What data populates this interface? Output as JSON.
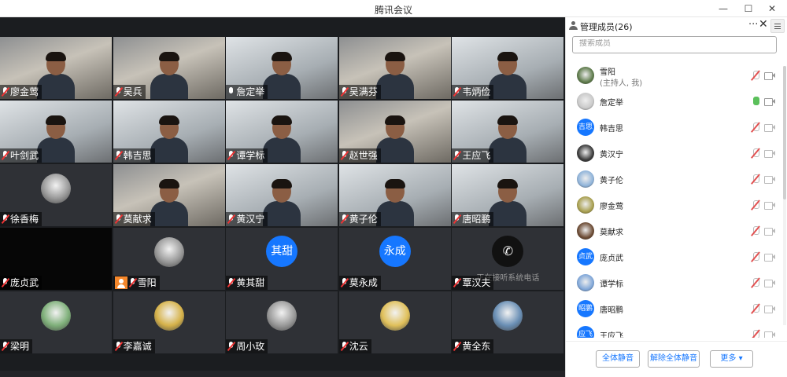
{
  "window": {
    "title": "腾讯会议",
    "minimize": "—",
    "maximize": "☐",
    "close": "✕"
  },
  "tiles": [
    {
      "name": "廖金莺",
      "mic": "off",
      "kind": "photo"
    },
    {
      "name": "吴兵",
      "mic": "off",
      "kind": "photo"
    },
    {
      "name": "詹定举",
      "mic": "on",
      "kind": "bright"
    },
    {
      "name": "吴满芬",
      "mic": "off",
      "kind": "photo"
    },
    {
      "name": "韦炳俭",
      "mic": "off",
      "kind": "bright"
    },
    {
      "name": "叶剑武",
      "mic": "off",
      "kind": "bright"
    },
    {
      "name": "韩吉思",
      "mic": "off",
      "kind": "bright"
    },
    {
      "name": "谭学标",
      "mic": "off",
      "kind": "bright"
    },
    {
      "name": "赵世强",
      "mic": "off",
      "kind": "photo"
    },
    {
      "name": "王应飞",
      "mic": "off",
      "kind": "bright"
    },
    {
      "name": "徐香梅",
      "mic": "off",
      "kind": "avatar"
    },
    {
      "name": "莫献求",
      "mic": "off",
      "kind": "photo"
    },
    {
      "name": "黄汉宁",
      "mic": "off",
      "kind": "bright"
    },
    {
      "name": "黄子伦",
      "mic": "off",
      "kind": "bright"
    },
    {
      "name": "唐昭鹏",
      "mic": "off",
      "kind": "bright"
    },
    {
      "name": "庞贞武",
      "mic": "off",
      "kind": "black"
    },
    {
      "name": "雪阳",
      "mic": "off",
      "kind": "avatar",
      "host": true
    },
    {
      "name": "黄其甜",
      "mic": "off",
      "kind": "text",
      "avatar_text": "其甜"
    },
    {
      "name": "莫永成",
      "mic": "off",
      "kind": "text",
      "avatar_text": "永成"
    },
    {
      "name": "覃汉夫",
      "mic": "off",
      "kind": "phone",
      "note": "正在接听系统电话"
    },
    {
      "name": "梁明",
      "mic": "off",
      "kind": "avatar"
    },
    {
      "name": "李嘉诚",
      "mic": "off",
      "kind": "avatar"
    },
    {
      "name": "周小玫",
      "mic": "off",
      "kind": "avatar"
    },
    {
      "name": "沈云",
      "mic": "off",
      "kind": "avatar"
    },
    {
      "name": "黄全东",
      "mic": "off",
      "kind": "avatar"
    }
  ],
  "panel": {
    "title": "管理成员(26)",
    "more": "···",
    "close": "✕",
    "search_placeholder": "搜索成员",
    "members": [
      {
        "name": "雪阳",
        "sub": "(主持人, 我)",
        "avatar": "image",
        "mic": "off",
        "cam": "on"
      },
      {
        "name": "詹定举",
        "sub": "",
        "avatar": "image",
        "mic": "on",
        "cam": "on"
      },
      {
        "name": "韩吉思",
        "sub": "",
        "avatar": "text",
        "avatar_text": "吉思",
        "mic": "off",
        "cam": "off"
      },
      {
        "name": "黄汉宁",
        "sub": "",
        "avatar": "image",
        "mic": "off",
        "cam": "off"
      },
      {
        "name": "黄子伦",
        "sub": "",
        "avatar": "image",
        "mic": "off",
        "cam": "off"
      },
      {
        "name": "廖金莺",
        "sub": "",
        "avatar": "image",
        "mic": "off",
        "cam": "off"
      },
      {
        "name": "莫献求",
        "sub": "",
        "avatar": "image",
        "mic": "off",
        "cam": "off"
      },
      {
        "name": "庞贞武",
        "sub": "",
        "avatar": "text",
        "avatar_text": "贞武",
        "mic": "off",
        "cam": "off"
      },
      {
        "name": "谭学标",
        "sub": "",
        "avatar": "image",
        "mic": "off",
        "cam": "off"
      },
      {
        "name": "唐昭鹏",
        "sub": "",
        "avatar": "text",
        "avatar_text": "昭鹏",
        "mic": "off",
        "cam": "off"
      },
      {
        "name": "王应飞",
        "sub": "",
        "avatar": "text",
        "avatar_text": "应飞",
        "mic": "off",
        "cam": "off"
      }
    ],
    "buttons": {
      "mute_all": "全体静音",
      "unmute_all": "解除全体静音",
      "more": "更多 ▾"
    }
  }
}
